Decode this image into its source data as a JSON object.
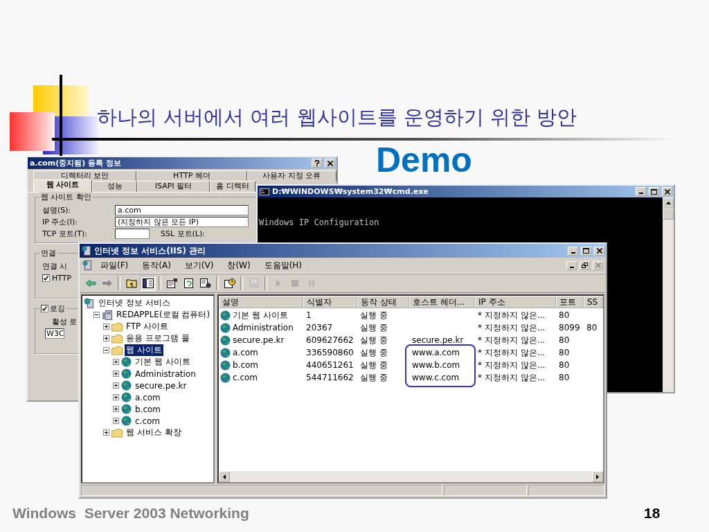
{
  "slide": {
    "title": "하나의 서버에서 여러 웹사이트를 운영하기 위한 방안",
    "subtitle": "Demo",
    "footer": "Windows  Server 2003 Networking",
    "page_number": "18"
  },
  "properties_dialog": {
    "title": "a.com(중지됨) 등록 정보",
    "tab_rows": [
      {
        "tabs": [
          {
            "label": "디렉터리 보안",
            "selected": false
          },
          {
            "label": "HTTP 헤더",
            "selected": false
          },
          {
            "label": "사용자 지정 오류",
            "selected": false
          }
        ]
      },
      {
        "tabs": [
          {
            "label": "웹 사이트",
            "selected": true
          },
          {
            "label": "성능",
            "selected": false
          },
          {
            "label": "ISAPI 필터",
            "selected": false
          },
          {
            "label": "홈 디렉터",
            "selected": false
          }
        ]
      }
    ],
    "identification": {
      "legend": "웹 사이트 확인",
      "description_label": "설명(S):",
      "description": "a.com",
      "ip_label": "IP 주소(I):",
      "ip": "(지정하지 않은 모든 IP)",
      "tcp_port_label": "TCP 포트(T):",
      "ssl_port_label": "SSL 포트(L):"
    },
    "connections": {
      "legend": "연결",
      "timeout_label": "연결 시",
      "keep_alive": {
        "label": "HTTP",
        "checked": true
      }
    },
    "logging": {
      "label": "로깅",
      "checked": true,
      "format_label": "활성 로",
      "format": "W3C"
    }
  },
  "console": {
    "title": "D:₩WINDOWS₩system32₩cmd.exe",
    "lines": [
      "Windows IP Configuration"
    ]
  },
  "iis": {
    "title": "인터넷 정보 서비스(IIS) 관리",
    "menu": [
      "파일(F)",
      "동작(A)",
      "보기(V)",
      "창(W)",
      "도움말(H)"
    ],
    "toolbar": [
      {
        "kind": "back",
        "pressed": false,
        "disabled": false
      },
      {
        "kind": "forward",
        "pressed": false,
        "disabled": false
      },
      {
        "kind": "separator"
      },
      {
        "kind": "up",
        "pressed": false,
        "disabled": false
      },
      {
        "kind": "tree",
        "pressed": true,
        "disabled": false
      },
      {
        "kind": "separator"
      },
      {
        "kind": "properties",
        "pressed": false,
        "disabled": false
      },
      {
        "kind": "refresh",
        "pressed": false,
        "disabled": false
      },
      {
        "kind": "export",
        "pressed": false,
        "disabled": false
      },
      {
        "kind": "separator"
      },
      {
        "kind": "help",
        "pressed": false,
        "disabled": false
      },
      {
        "kind": "separator"
      },
      {
        "kind": "computer",
        "pressed": false,
        "disabled": true
      },
      {
        "kind": "separator"
      },
      {
        "kind": "play",
        "pressed": false,
        "disabled": true
      },
      {
        "kind": "stop",
        "pressed": false,
        "disabled": true
      },
      {
        "kind": "pause",
        "pressed": false,
        "disabled": true
      }
    ],
    "tree": [
      {
        "label": "인터넷 정보 서비스",
        "kind": "services",
        "selected": false,
        "children": [
          {
            "label": "REDAPPLE(로컬 컴퓨터)",
            "kind": "computer",
            "expanded": true,
            "selected": false,
            "children": [
              {
                "label": "FTP 사이트",
                "kind": "folder",
                "expanded": false,
                "selected": false
              },
              {
                "label": "응용 프로그램 풀",
                "kind": "folder",
                "expanded": false,
                "selected": false
              },
              {
                "label": "웹 사이트",
                "kind": "folder",
                "expanded": true,
                "selected": true,
                "children": [
                  {
                    "label": "기본 웹 사이트",
                    "kind": "site",
                    "expanded": false,
                    "selected": false
                  },
                  {
                    "label": "Administration",
                    "kind": "site",
                    "expanded": false,
                    "selected": false
                  },
                  {
                    "label": "secure.pe.kr",
                    "kind": "site",
                    "expanded": false,
                    "selected": false
                  },
                  {
                    "label": "a.com",
                    "kind": "site",
                    "expanded": false,
                    "selected": false
                  },
                  {
                    "label": "b.com",
                    "kind": "site",
                    "expanded": false,
                    "selected": false
                  },
                  {
                    "label": "c.com",
                    "kind": "site",
                    "expanded": false,
                    "selected": false
                  }
                ]
              },
              {
                "label": "웹 서비스 확장",
                "kind": "folder",
                "expanded": false,
                "selected": false
              }
            ]
          }
        ]
      }
    ],
    "list": {
      "columns": [
        "설명",
        "식별자",
        "동작 상태",
        "호스트 헤더...",
        "IP 주소",
        "포트",
        "SS"
      ],
      "rows": [
        {
          "cells": [
            "기본 웹 사이트",
            "1",
            "실행 중",
            "",
            "* 지정하지 않은...",
            "80",
            ""
          ],
          "boxed": false
        },
        {
          "cells": [
            "Administration",
            "20367",
            "실행 중",
            "",
            "* 지정하지 않은...",
            "8099",
            "80"
          ],
          "boxed": false
        },
        {
          "cells": [
            "secure.pe.kr",
            "609627662",
            "실행 중",
            "secure.pe.kr",
            "* 지정하지 않은...",
            "80",
            ""
          ],
          "boxed": false
        },
        {
          "cells": [
            "a.com",
            "336590860",
            "실행 중",
            "www.a.com",
            "* 지정하지 않은...",
            "80",
            ""
          ],
          "boxed": true
        },
        {
          "cells": [
            "b.com",
            "440651261",
            "실행 중",
            "www.b.com",
            "* 지정하지 않은...",
            "80",
            ""
          ],
          "boxed": true
        },
        {
          "cells": [
            "c.com",
            "544711662",
            "실행 중",
            "www.c.com",
            "* 지정하지 않은...",
            "80",
            ""
          ],
          "boxed": true
        }
      ]
    }
  }
}
